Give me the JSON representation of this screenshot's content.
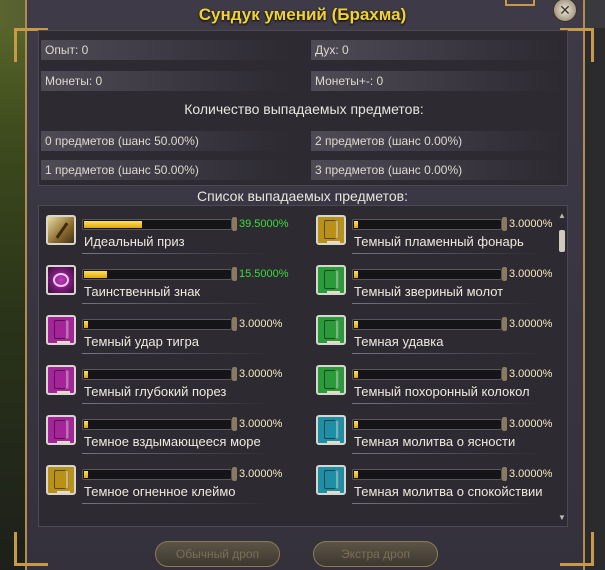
{
  "window": {
    "title": "Сундук умений (Брахма)",
    "close_glyph": "✕"
  },
  "stats": {
    "exp": "Опыт: 0",
    "spirit": "Дух: 0",
    "coins": "Монеты: 0",
    "coins_plus": "Монеты+-: 0"
  },
  "drop_count": {
    "heading": "Количество выпадаемых предметов:",
    "options": [
      "0 предметов (шанс 50.00%)",
      "2 предметов (шанс 0.00%)",
      "1 предметов (шанс 50.00%)",
      "3 предметов (шанс 0.00%)"
    ]
  },
  "drop_list": {
    "heading": "Список выпадаемых предметов:",
    "items": [
      {
        "name": "Идеальный приз",
        "percent": "39.5000%",
        "value": 39.5,
        "icon": "scroll-icon",
        "highlight": true
      },
      {
        "name": "Темный пламенный фонарь",
        "percent": "3.0000%",
        "value": 3.0,
        "icon": "gold-book-icon",
        "highlight": false
      },
      {
        "name": "Таинственный знак",
        "percent": "15.5000%",
        "value": 15.5,
        "icon": "mystic-sign-icon",
        "highlight": true
      },
      {
        "name": "Темный звериный молот",
        "percent": "3.0000%",
        "value": 3.0,
        "icon": "green-book-icon",
        "highlight": false
      },
      {
        "name": "Темный удар тигра",
        "percent": "3.0000%",
        "value": 3.0,
        "icon": "purple-book-icon",
        "highlight": false
      },
      {
        "name": "Темная удавка",
        "percent": "3.0000%",
        "value": 3.0,
        "icon": "green-book-icon",
        "highlight": false
      },
      {
        "name": "Темный глубокий порез",
        "percent": "3.0000%",
        "value": 3.0,
        "icon": "purple-book-icon",
        "highlight": false
      },
      {
        "name": "Темный похоронный колокол",
        "percent": "3.0000%",
        "value": 3.0,
        "icon": "green-book-icon",
        "highlight": false
      },
      {
        "name": "Темное вздымающееся море",
        "percent": "3.0000%",
        "value": 3.0,
        "icon": "purple-book-icon",
        "highlight": false
      },
      {
        "name": "Темная молитва о ясности",
        "percent": "3.0000%",
        "value": 3.0,
        "icon": "teal-book-icon",
        "highlight": false
      },
      {
        "name": "Темное огненное клеймо",
        "percent": "3.0000%",
        "value": 3.0,
        "icon": "gold-book-icon",
        "highlight": false
      },
      {
        "name": "Темная молитва о спокойствии",
        "percent": "3.0000%",
        "value": 3.0,
        "icon": "teal-book-icon",
        "highlight": false
      }
    ]
  },
  "footer": {
    "normal_drop": "Обычный дроп",
    "extra_drop": "Экстра дроп"
  },
  "colors": {
    "title": "#f2d233",
    "frame": "#b08d4c",
    "bar_fill": "#e0a810",
    "highlight_percent": "#3adc3a"
  }
}
